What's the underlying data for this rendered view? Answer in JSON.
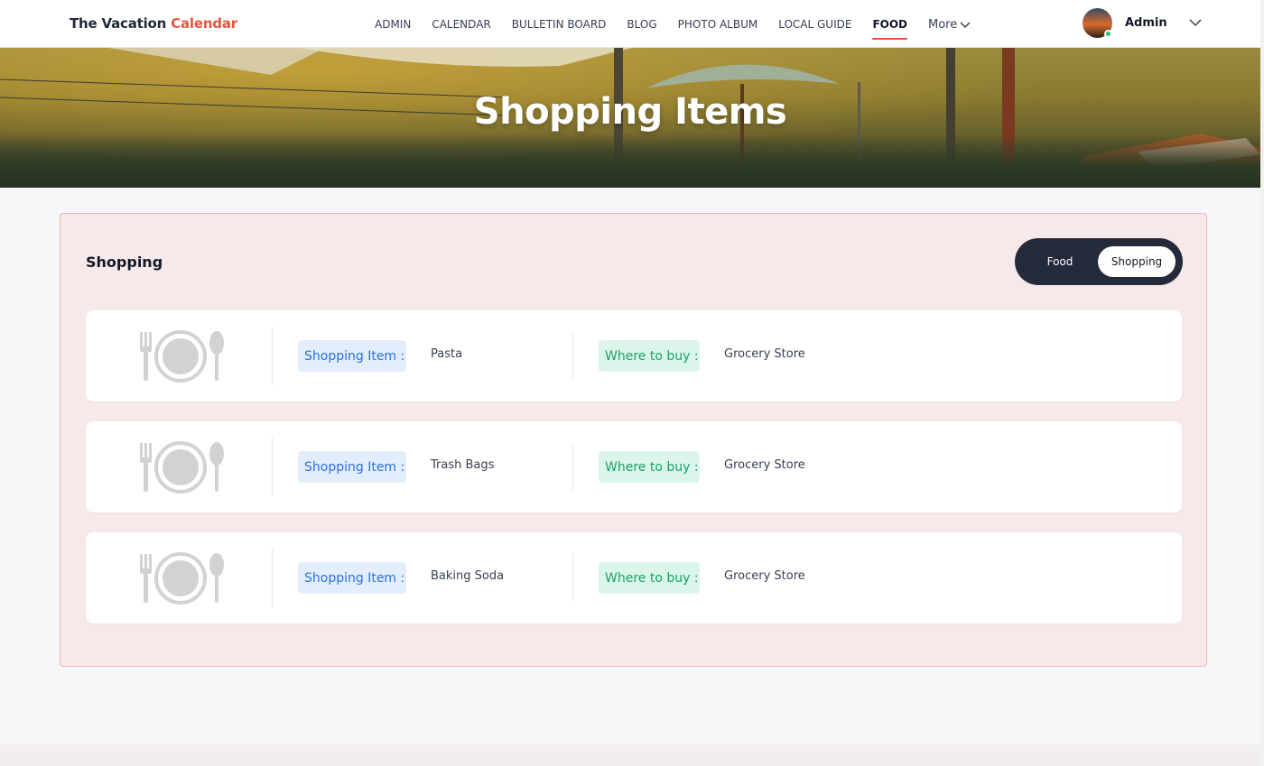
{
  "header": {
    "brand_main": "The Vacation",
    "brand_accent": "Calendar",
    "nav": [
      "ADMIN",
      "CALENDAR",
      "BULLETIN BOARD",
      "BLOG",
      "PHOTO ALBUM",
      "LOCAL GUIDE",
      "FOOD"
    ],
    "active_nav": "FOOD",
    "more_label": "More",
    "user_name": "Admin"
  },
  "hero": {
    "title": "Shopping Items"
  },
  "panel": {
    "title": "Shopping",
    "toggle": {
      "food": "Food",
      "shopping": "Shopping",
      "selected": "Shopping"
    },
    "item_label": "Shopping Item :",
    "where_label": "Where to buy :",
    "rows": [
      {
        "item": "Pasta",
        "where": "Grocery Store",
        "icon": "plate-cutlery-icon"
      },
      {
        "item": "Trash Bags",
        "where": "Grocery Store",
        "icon": "plate-cutlery-icon"
      },
      {
        "item": "Baking Soda",
        "where": "Grocery Store",
        "icon": "plate-cutlery-icon"
      }
    ]
  },
  "colors": {
    "accent": "#e0573f",
    "panel_bg": "#f7e9ea",
    "toggle_bg": "#252a3a",
    "item_badge": "#2d6fe0",
    "where_badge": "#17a36b",
    "online": "#22c55e"
  }
}
